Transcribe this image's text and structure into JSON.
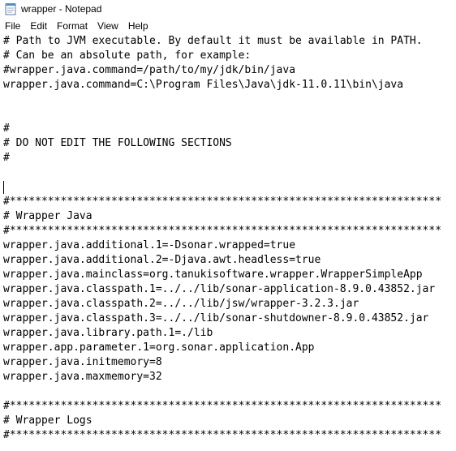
{
  "window": {
    "title": "wrapper - Notepad",
    "icon": "notepad-icon"
  },
  "menu": {
    "items": [
      {
        "label": "File"
      },
      {
        "label": "Edit"
      },
      {
        "label": "Format"
      },
      {
        "label": "View"
      },
      {
        "label": "Help"
      }
    ]
  },
  "editor": {
    "caret_line": 12,
    "lines": [
      "# Path to JVM executable. By default it must be available in PATH.",
      "# Can be an absolute path, for example:",
      "#wrapper.java.command=/path/to/my/jdk/bin/java",
      "wrapper.java.command=C:\\Program Files\\Java\\jdk-11.0.11\\bin\\java",
      "",
      "",
      "#",
      "# DO NOT EDIT THE FOLLOWING SECTIONS",
      "#",
      "",
      "",
      "#********************************************************************",
      "# Wrapper Java",
      "#********************************************************************",
      "wrapper.java.additional.1=-Dsonar.wrapped=true",
      "wrapper.java.additional.2=-Djava.awt.headless=true",
      "wrapper.java.mainclass=org.tanukisoftware.wrapper.WrapperSimpleApp",
      "wrapper.java.classpath.1=../../lib/sonar-application-8.9.0.43852.jar",
      "wrapper.java.classpath.2=../../lib/jsw/wrapper-3.2.3.jar",
      "wrapper.java.classpath.3=../../lib/sonar-shutdowner-8.9.0.43852.jar",
      "wrapper.java.library.path.1=./lib",
      "wrapper.app.parameter.1=org.sonar.application.App",
      "wrapper.java.initmemory=8",
      "wrapper.java.maxmemory=32",
      "",
      "#********************************************************************",
      "# Wrapper Logs",
      "#********************************************************************"
    ]
  }
}
